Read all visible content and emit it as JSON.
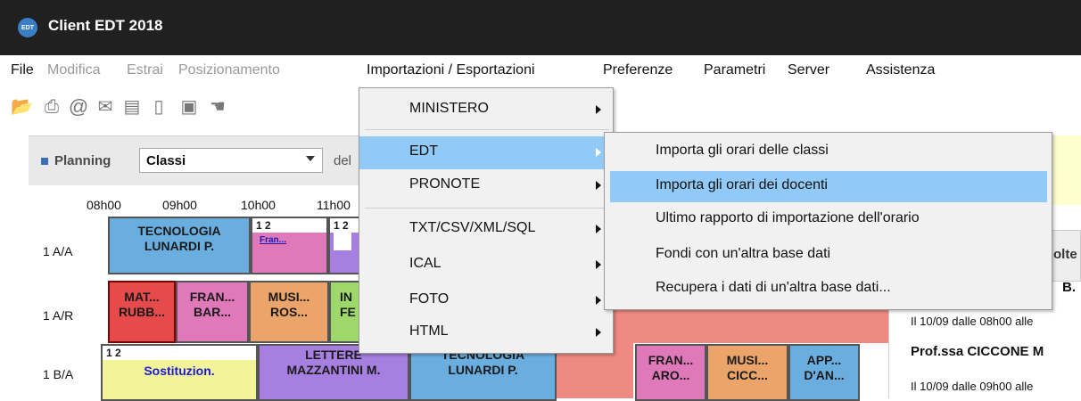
{
  "window": {
    "title": "Client EDT 2018",
    "logo": "EDT"
  },
  "menubar": [
    {
      "label": "File",
      "disabled": false
    },
    {
      "label": "Modifica",
      "disabled": true
    },
    {
      "label": "Estrai",
      "disabled": true
    },
    {
      "label": "Posizionamento",
      "disabled": true
    },
    {
      "label": "Importazioni / Esportazioni",
      "disabled": false
    },
    {
      "label": "Preferenze",
      "disabled": false
    },
    {
      "label": "Parametri",
      "disabled": false
    },
    {
      "label": "Server",
      "disabled": false
    },
    {
      "label": "Assistenza",
      "disabled": false
    }
  ],
  "toolbar": {
    "icons": [
      "open-folder-icon",
      "print-icon",
      "at-icon",
      "mail-icon",
      "notepad-icon",
      "phone-icon",
      "message-icon",
      "chat-icon"
    ]
  },
  "planning": {
    "label": "Planning",
    "select_value": "Classi",
    "del_label": "del",
    "times": [
      "08h00",
      "09h00",
      "10h00",
      "11h00"
    ],
    "rows": [
      "1 A/A",
      "1 A/R",
      "1 B/A"
    ]
  },
  "cells": {
    "tecnologia_a": {
      "l1": "TECNOLOGIA",
      "l2": "LUNARDI P."
    },
    "weeks_a1": "1  2",
    "fran_small": "Fran...",
    "weeks_a2": "1  2",
    "mat": {
      "l1": "MAT...",
      "l2": "RUBB..."
    },
    "fran_r": {
      "l1": "FRAN...",
      "l2": "BAR..."
    },
    "musi_r": {
      "l1": "MUSI...",
      "l2": "ROS..."
    },
    "in_r": {
      "l1": "IN",
      "l2": "FE"
    },
    "weeks_b": "1  2",
    "sostituzion": "Sostituzion.",
    "lettere": {
      "l1": "LETTERE",
      "l2": "MAZZANTINI M."
    },
    "tecnologia_b": {
      "l1": "TECNOLOGIA",
      "l2": "LUNARDI P."
    },
    "fran_b": {
      "l1": "FRAN...",
      "l2": "ARO..."
    },
    "musi_b": {
      "l1": "MUSI...",
      "l2": "CICC..."
    },
    "app_b": {
      "l1": "APP...",
      "l2": "D'AN..."
    }
  },
  "right_panel": {
    "tab_text": "olte",
    "line1": "B.",
    "line2": "Il 10/09 dalle 08h00 alle",
    "line3": "Prof.ssa CICCONE M",
    "line4": "Il 10/09 dalle 09h00 alle"
  },
  "menu_importazioni": {
    "items": [
      {
        "label": "MINISTERO",
        "submenu": true
      },
      {
        "label": "EDT",
        "submenu": true,
        "highlighted": true
      },
      {
        "label": "PRONOTE",
        "submenu": true
      },
      {
        "label": "TXT/CSV/XML/SQL",
        "submenu": true
      },
      {
        "label": "ICAL",
        "submenu": true
      },
      {
        "label": "FOTO",
        "submenu": true
      },
      {
        "label": "HTML",
        "submenu": true
      }
    ]
  },
  "menu_edt": {
    "items": [
      {
        "label": "Importa gli orari delle classi"
      },
      {
        "label": "Importa gli orari dei docenti",
        "highlighted": true
      },
      {
        "label": "Ultimo rapporto di importazione dell'orario"
      },
      {
        "label": "Fondi con un'altra base dati"
      },
      {
        "label": "Recupera i dati di un'altra base dati..."
      }
    ]
  },
  "colors": {
    "titlebar": "#202020",
    "highlight": "#91c9f7",
    "tecnologia": "#6aaee0",
    "lettere": "#a77fe0",
    "salmon": "#ef8a82"
  }
}
